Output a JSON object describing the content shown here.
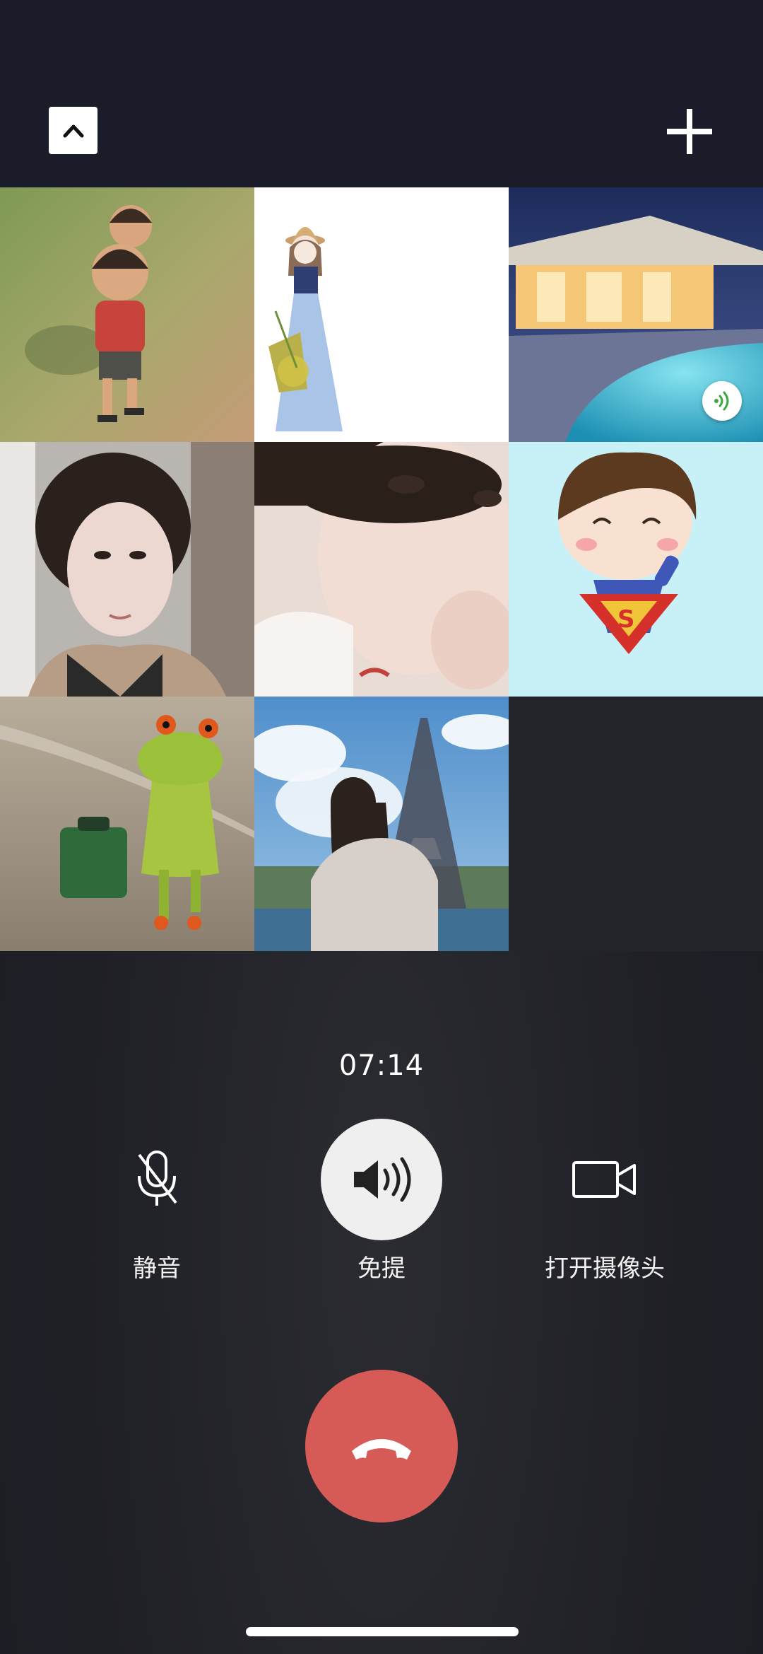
{
  "call": {
    "duration": "07:14"
  },
  "header": {
    "collapse_icon": "chevron-up-icon",
    "add_icon": "plus-icon"
  },
  "participants": [
    {
      "avatar": "cartoon-two-boys"
    },
    {
      "avatar": "illustrated-girl-with-hat"
    },
    {
      "avatar": "villa-pool-night",
      "speaking": true,
      "speaking_icon": "speaking-indicator-icon"
    },
    {
      "avatar": "woman-selfie"
    },
    {
      "avatar": "girl-selfie"
    },
    {
      "avatar": "superman-boy-cartoon"
    },
    {
      "avatar": "frog-figurine"
    },
    {
      "avatar": "girl-eiffel-tower"
    }
  ],
  "controls": {
    "mute": {
      "label": "静音",
      "icon": "microphone-icon"
    },
    "speaker": {
      "label": "免提",
      "icon": "speaker-icon",
      "active": true
    },
    "camera": {
      "label": "打开摄像头",
      "icon": "video-camera-icon"
    }
  },
  "hangup": {
    "icon": "hang-up-icon"
  },
  "colors": {
    "header_bg": "#1b1c2a",
    "hangup_red": "#d65a55",
    "speaker_active_bg": "#efeff0",
    "speaking_green": "#3aa83d"
  }
}
